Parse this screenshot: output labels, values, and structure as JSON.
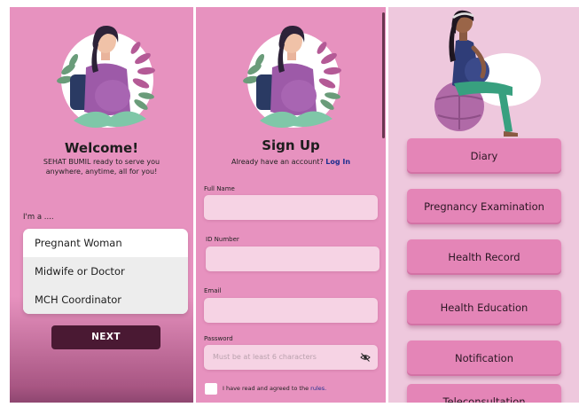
{
  "colors": {
    "primary_pink": "#e792bf",
    "menu_background": "#eec8dd",
    "menu_button": "#e485b7",
    "next_button": "#4a1933",
    "link": "#1e2f8f",
    "input_fill": "#f6d3e4"
  },
  "welcome": {
    "title": "Welcome!",
    "subtitle_line1": "SEHAT BUMIL ready to serve you",
    "subtitle_line2": "anywhere, anytime, all for you!",
    "role_label": "I'm a ....",
    "roles": [
      "Pregnant Woman",
      "Midwife or Doctor",
      "MCH Coordinator"
    ],
    "next_label": "NEXT",
    "illustration": "pregnant-woman-illustration"
  },
  "signup": {
    "title": "Sign Up",
    "login_prompt": "Already have an account?",
    "login_link": "Log In",
    "fields": [
      {
        "label": "Full Name",
        "value": "",
        "placeholder": ""
      },
      {
        "label": "ID Number",
        "value": "",
        "placeholder": ""
      },
      {
        "label": "Email",
        "value": "",
        "placeholder": ""
      },
      {
        "label": "Password",
        "value": "",
        "placeholder": "Must be at least 6 characters"
      }
    ],
    "password_toggle_icon": "eye-off-icon",
    "agree_text": "I have read and agreed to the",
    "agree_link": "rules."
  },
  "menu": {
    "illustration": "pregnant-woman-on-ball-illustration",
    "items": [
      "Diary",
      "Pregnancy Examination",
      "Health Record",
      "Health Education",
      "Notification",
      "Teleconsultation"
    ]
  }
}
